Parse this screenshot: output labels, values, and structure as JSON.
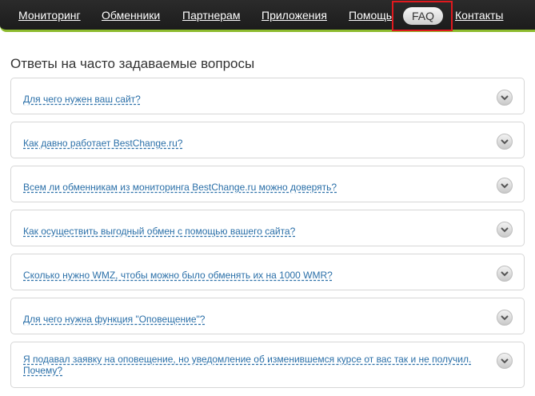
{
  "nav": {
    "items": [
      {
        "label": "Мониторинг"
      },
      {
        "label": "Обменники"
      },
      {
        "label": "Партнерам"
      },
      {
        "label": "Приложения"
      },
      {
        "label": "Помощь"
      },
      {
        "label": "FAQ"
      },
      {
        "label": "Контакты"
      }
    ]
  },
  "page": {
    "title": "Ответы на часто задаваемые вопросы"
  },
  "faq": {
    "items": [
      {
        "question": "Для чего нужен ваш сайт?"
      },
      {
        "question": "Как давно работает BestChange.ru?"
      },
      {
        "question": "Всем ли обменникам из мониторинга BestChange.ru можно доверять?"
      },
      {
        "question": "Как осуществить выгодный обмен с помощью вашего сайта?"
      },
      {
        "question": "Сколько нужно WMZ, чтобы можно было обменять их на 1000 WMR?"
      },
      {
        "question": "Для чего нужна функция \"Оповещение\"?"
      },
      {
        "question": "Я подавал заявку на оповещение, но уведомление об изменившемся курсе от вас так и не получил. Почему?"
      }
    ]
  },
  "colors": {
    "nav_background": "#222222",
    "nav_accent": "#8dbb2e",
    "link": "#2a6fa8",
    "highlight": "#e0191e"
  },
  "icons": {
    "toggle": "chevron-down-icon"
  }
}
